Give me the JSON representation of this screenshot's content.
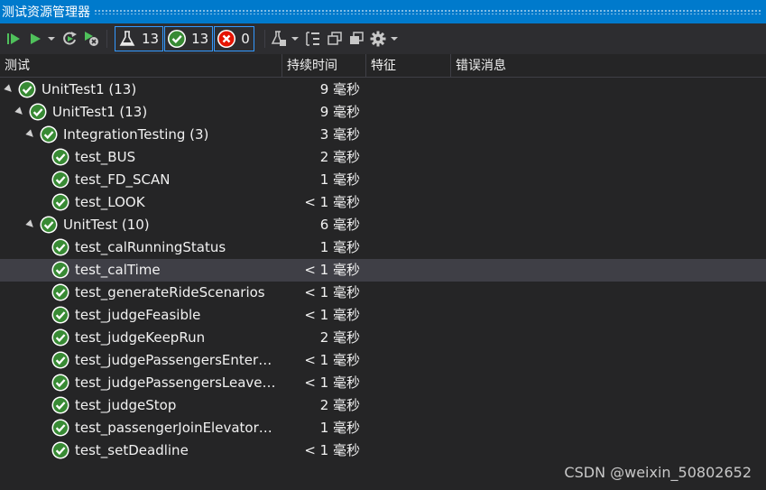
{
  "window": {
    "title": "测试资源管理器"
  },
  "toolbar": {
    "run_all_icon": "run-all-icon",
    "run_icon": "play-icon",
    "repeat_icon": "repeat-run-icon",
    "cancel_icon": "cancel-run-icon",
    "filters": [
      {
        "icon": "flask-icon",
        "count": "13"
      },
      {
        "icon": "passed-icon",
        "count": "13"
      },
      {
        "icon": "failed-icon",
        "count": "0"
      }
    ],
    "playlist_icon": "playlist-icon",
    "group_icon": "group-by-icon",
    "copy_icon": "copy-icon",
    "settings_icon": "gear-icon"
  },
  "columns": {
    "test": "测试",
    "duration": "持续时间",
    "traits": "特征",
    "error": "错误消息"
  },
  "colors": {
    "accent": "#007acc",
    "pass": "#388a34",
    "fail": "#e51400",
    "selected": "#3f3f46"
  },
  "tree": [
    {
      "label": "UnitTest1 (13)",
      "duration": "9 毫秒",
      "level": 0,
      "expanded": true
    },
    {
      "label": "UnitTest1 (13)",
      "duration": "9 毫秒",
      "level": 1,
      "expanded": true
    },
    {
      "label": "IntegrationTesting (3)",
      "duration": "3 毫秒",
      "level": 2,
      "expanded": true
    },
    {
      "label": "test_BUS",
      "duration": "2 毫秒",
      "level": 3
    },
    {
      "label": "test_FD_SCAN",
      "duration": "1 毫秒",
      "level": 3
    },
    {
      "label": "test_LOOK",
      "duration": "< 1 毫秒",
      "level": 3
    },
    {
      "label": "UnitTest (10)",
      "duration": "6 毫秒",
      "level": 2,
      "expanded": true
    },
    {
      "label": "test_calRunningStatus",
      "duration": "1 毫秒",
      "level": 3
    },
    {
      "label": "test_calTime",
      "duration": "< 1 毫秒",
      "level": 3,
      "selected": true
    },
    {
      "label": "test_generateRideScenarios",
      "duration": "< 1 毫秒",
      "level": 3
    },
    {
      "label": "test_judgeFeasible",
      "duration": "< 1 毫秒",
      "level": 3
    },
    {
      "label": "test_judgeKeepRun",
      "duration": "2 毫秒",
      "level": 3
    },
    {
      "label": "test_judgePassengersEnterEl...",
      "duration": "< 1 毫秒",
      "level": 3
    },
    {
      "label": "test_judgePassengersLeaveEl...",
      "duration": "< 1 毫秒",
      "level": 3
    },
    {
      "label": "test_judgeStop",
      "duration": "2 毫秒",
      "level": 3
    },
    {
      "label": "test_passengerJoinElevatorsF...",
      "duration": "1 毫秒",
      "level": 3
    },
    {
      "label": "test_setDeadline",
      "duration": "< 1 毫秒",
      "level": 3
    }
  ],
  "watermark": "CSDN @weixin_50802652"
}
